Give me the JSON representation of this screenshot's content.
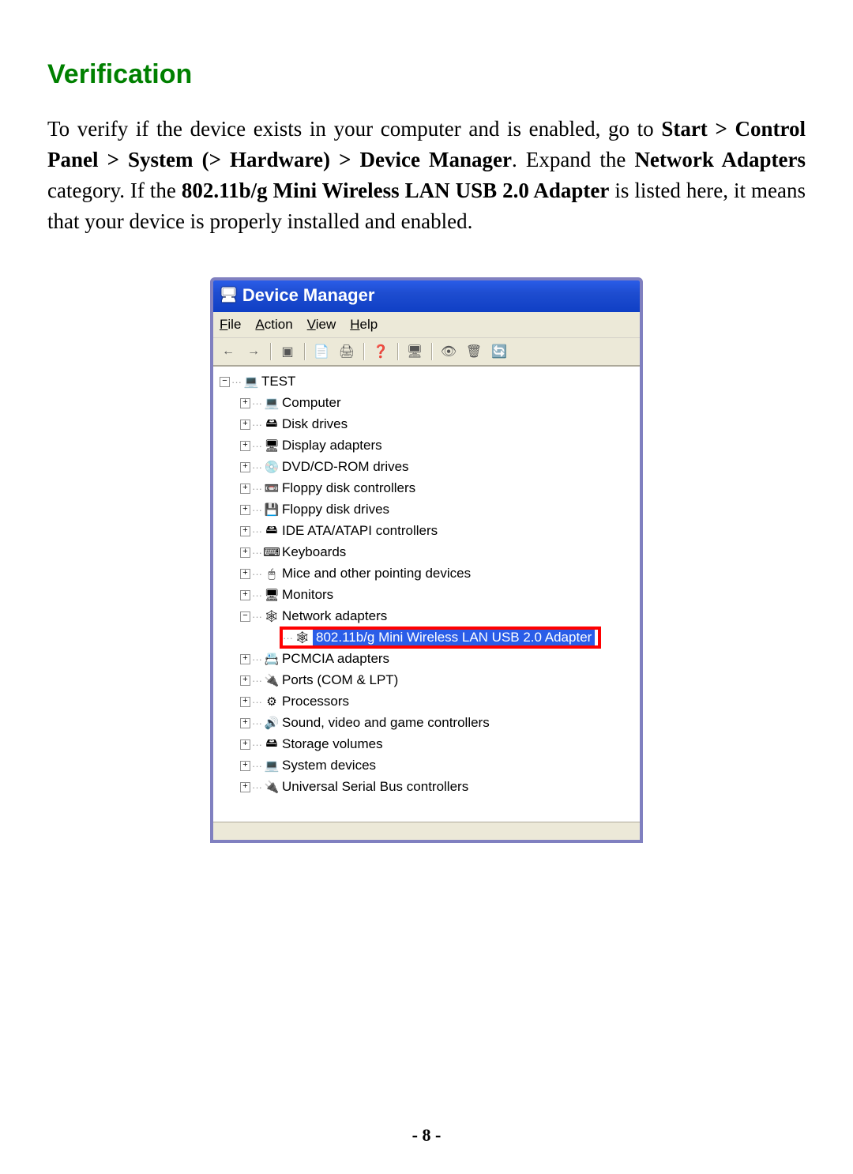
{
  "doc": {
    "section_title": "Verification",
    "para_pre": "To verify if the device exists in your computer and is enabled, go to ",
    "para_b1": "Start > Control Panel > System (> Hardware) > Device Manager",
    "para_mid1": ". Expand the ",
    "para_b2": "Network Adapters",
    "para_mid2": " category. If the ",
    "para_b3": "802.11b/g Mini Wireless LAN USB 2.0 Adapter",
    "para_end": " is listed here, it means that your device is properly installed and enabled.",
    "page_number": "- 8 -"
  },
  "window": {
    "title": "Device Manager",
    "menu": {
      "file": "File",
      "action": "Action",
      "view": "View",
      "help": "Help"
    }
  },
  "tree": {
    "root": "TEST",
    "items": [
      "Computer",
      "Disk drives",
      "Display adapters",
      "DVD/CD-ROM drives",
      "Floppy disk controllers",
      "Floppy disk drives",
      "IDE ATA/ATAPI controllers",
      "Keyboards",
      "Mice and other pointing devices",
      "Monitors",
      "Network adapters",
      "PCMCIA adapters",
      "Ports (COM & LPT)",
      "Processors",
      "Sound, video and game controllers",
      "Storage volumes",
      "System devices",
      "Universal Serial Bus controllers"
    ],
    "highlighted_child": "802.11b/g Mini Wireless LAN USB 2.0 Adapter"
  },
  "icons": {
    "root": "💻",
    "nodes": [
      "💻",
      "🖴",
      "🖥",
      "💿",
      "📼",
      "💾",
      "🖴",
      "⌨",
      "🖱",
      "🖥",
      "🕸",
      "📇",
      "🔌",
      "⚙",
      "🔊",
      "🖴",
      "💻",
      "🔌"
    ],
    "child": "🕸"
  },
  "expanders": {
    "plus": "+",
    "minus": "−"
  }
}
